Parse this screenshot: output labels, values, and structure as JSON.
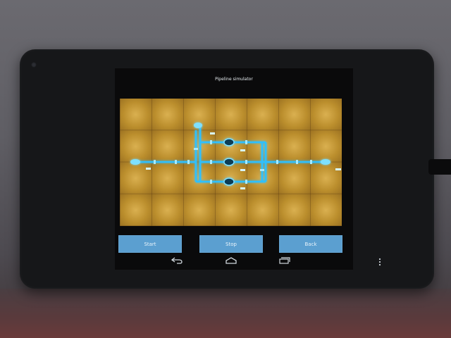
{
  "app": {
    "title": "Pipeline simulator"
  },
  "buttons": {
    "start": "Start",
    "stop": "Stop",
    "back": "Back"
  },
  "navigation": {
    "icons": [
      "back-arrow-icon",
      "home-icon",
      "recent-apps-icon",
      "overflow-menu-icon"
    ]
  },
  "colors": {
    "pipe": "#39c6ff",
    "board": "#b98d2c",
    "button": "#5b9fd0"
  }
}
